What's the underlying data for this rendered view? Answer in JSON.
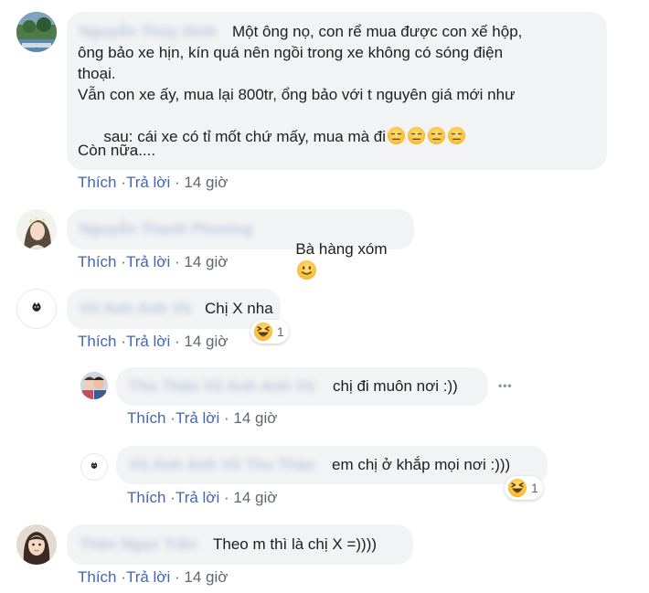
{
  "comments": [
    {
      "author": "Nguyễn Thủy Dinh",
      "text_lines": [
        "Một ông nọ, con rể mua được con xế hộp,",
        "ông bảo xe hịn, kín quá nên ngồi trong xe không có sóng điện",
        "thoại.",
        "Vẫn con xe ấy, mua lại 800tr, ổng bảo với t nguyên giá mới như",
        "sau: cái xe có tỉ mốt chứ mấy, mua mà đi"
      ],
      "emoji_trail": "expressionless-face x4",
      "text_more": "Còn nữa....",
      "like": "Thích",
      "reply": "Trả lời",
      "time": "14 giờ",
      "avatar_icon": "scenery-avatar-icon"
    },
    {
      "author": "Nguyễn Thanh Phương",
      "text": "Bà hàng xóm",
      "emoji": "slightly-smiling-face",
      "like": "Thích",
      "reply": "Trả lời",
      "time": "14 giờ",
      "avatar_icon": "girl-avatar-icon"
    },
    {
      "author": "Vũ Anh Anh Vũ",
      "text": "Chị X nha",
      "reaction_count": "1",
      "reaction": "haha",
      "like": "Thích",
      "reply": "Trả lời",
      "time": "14 giờ",
      "avatar_icon": "cat-avatar-icon",
      "replies": [
        {
          "author": "Thu Thảo Vũ Anh Anh Vũ",
          "text": "chị đi muôn nơi :))",
          "more": "•••",
          "like": "Thích",
          "reply": "Trả lời",
          "time": "14 giờ",
          "avatar_icon": "couple-avatar-icon"
        },
        {
          "author": "Vũ Anh Anh Vũ Thu Thảo",
          "text": "em chị ở khắp mọi nơi :)))",
          "reaction_count": "1",
          "reaction": "haha",
          "like": "Thích",
          "reply": "Trả lời",
          "time": "14 giờ",
          "avatar_icon": "cat-avatar-icon"
        }
      ]
    },
    {
      "author": "Thảo Ngọc Trần",
      "text": "Theo m thì là chị X =))))",
      "like": "Thích",
      "reply": "Trả lời",
      "time": "14 giờ",
      "avatar_icon": "woman-avatar-icon"
    }
  ],
  "separator": "·",
  "colors": {
    "link": "#4267b2",
    "bubble": "#f2f3f5",
    "muted": "#606770",
    "text": "#1c1e21"
  }
}
